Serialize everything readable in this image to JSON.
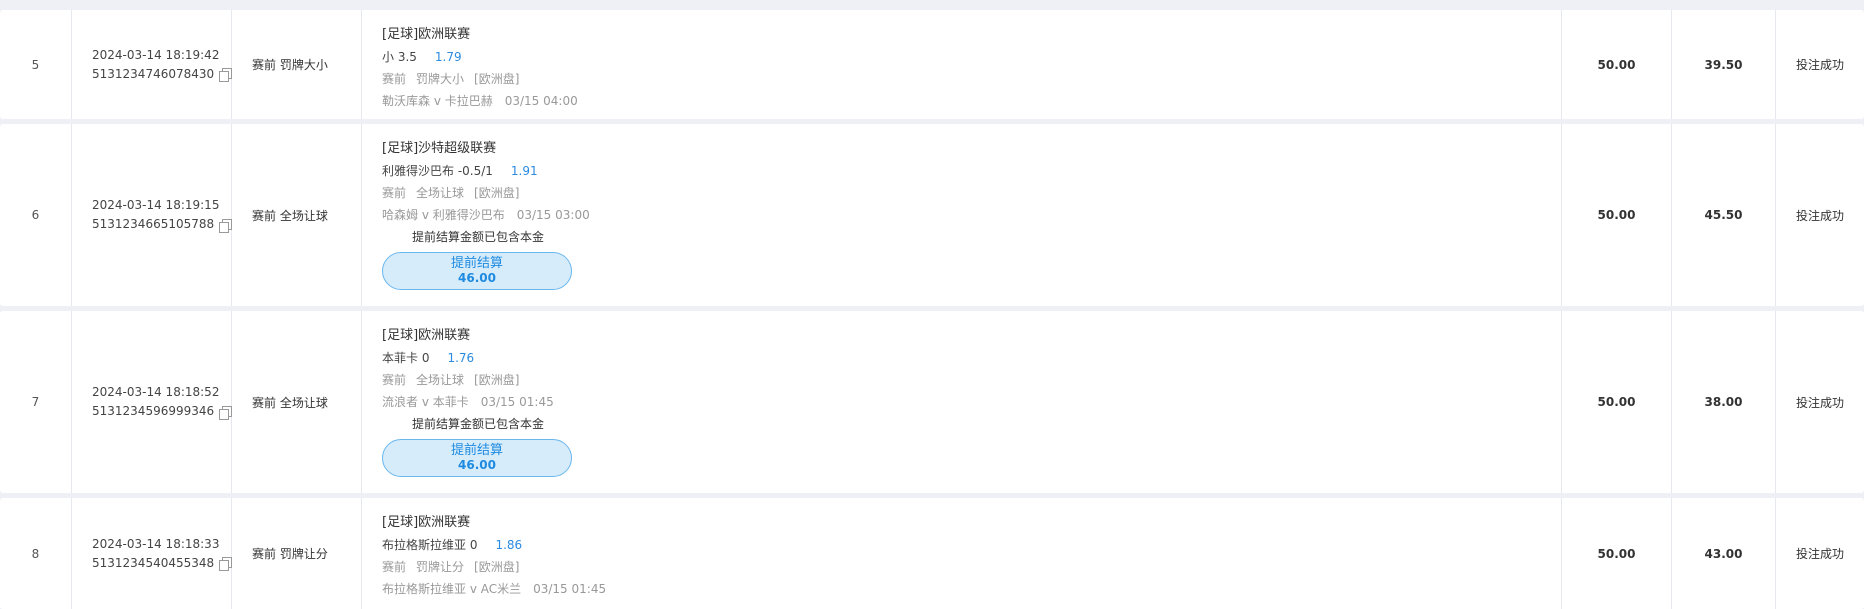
{
  "rows": [
    {
      "index": "5",
      "time": "2024-03-14 18:19:42",
      "order_no": "5131234746078430",
      "bet_type": "赛前 罚牌大小",
      "league": "[足球]欧洲联赛",
      "pick": "小 3.5",
      "odds": "1.79",
      "meta": [
        "赛前",
        "罚牌大小",
        "[欧洲盘]"
      ],
      "match": "勒沃库森 v 卡拉巴赫",
      "match_time": "03/15 04:00",
      "stake": "50.00",
      "win": "39.50",
      "status": "投注成功"
    },
    {
      "index": "6",
      "time": "2024-03-14 18:19:15",
      "order_no": "5131234665105788",
      "bet_type": "赛前 全场让球",
      "league": "[足球]沙特超级联赛",
      "pick": "利雅得沙巴布 -0.5/1",
      "odds": "1.91",
      "meta": [
        "赛前",
        "全场让球",
        "[欧洲盘]"
      ],
      "match": "哈森姆 v 利雅得沙巴布",
      "match_time": "03/15 03:00",
      "note": "提前结算金额已包含本金",
      "cashout_label": "提前结算",
      "cashout_amount": "46.00",
      "stake": "50.00",
      "win": "45.50",
      "status": "投注成功"
    },
    {
      "index": "7",
      "time": "2024-03-14 18:18:52",
      "order_no": "5131234596999346",
      "bet_type": "赛前 全场让球",
      "league": "[足球]欧洲联赛",
      "pick": "本菲卡 0",
      "odds": "1.76",
      "meta": [
        "赛前",
        "全场让球",
        "[欧洲盘]"
      ],
      "match": "流浪者 v 本菲卡",
      "match_time": "03/15 01:45",
      "note": "提前结算金额已包含本金",
      "cashout_label": "提前结算",
      "cashout_amount": "46.00",
      "stake": "50.00",
      "win": "38.00",
      "status": "投注成功"
    },
    {
      "index": "8",
      "time": "2024-03-14 18:18:33",
      "order_no": "5131234540455348",
      "bet_type": "赛前 罚牌让分",
      "league": "[足球]欧洲联赛",
      "pick": "布拉格斯拉维亚 0",
      "odds": "1.86",
      "meta": [
        "赛前",
        "罚牌让分",
        "[欧洲盘]"
      ],
      "match": "布拉格斯拉维亚 v AC米兰",
      "match_time": "03/15 01:45",
      "stake": "50.00",
      "win": "43.00",
      "status": "投注成功"
    }
  ],
  "icons": {
    "copy": "copy-icon"
  },
  "colors": {
    "accent": "#2b8be0",
    "cashout_bg": "#d6ecfb",
    "page_bg": "#eef0f5"
  }
}
